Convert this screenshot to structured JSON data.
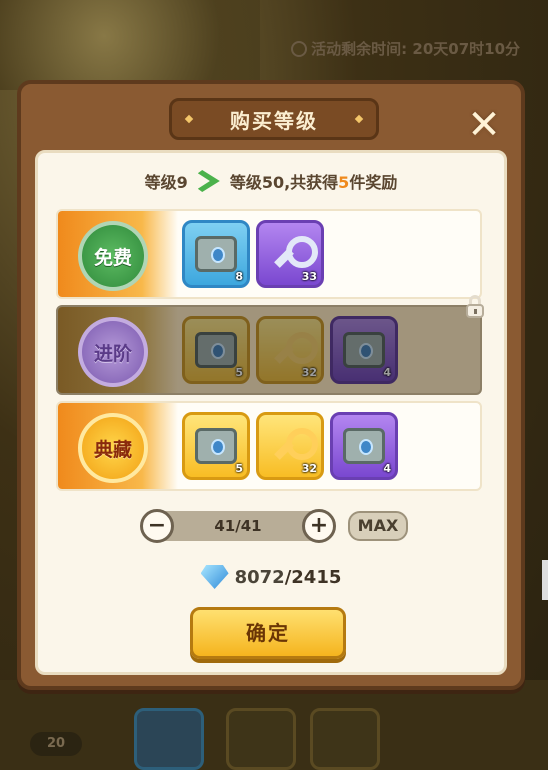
{
  "background": {
    "timer_text": "活动剩余时间: 20天07时10分",
    "chip_value": "20"
  },
  "dialog": {
    "title": "购买等级",
    "close_icon": "close-icon",
    "summary": {
      "from_level": "等级9",
      "to_level": "等级50,共获得",
      "reward_count": "5",
      "reward_suffix": "件奖励"
    },
    "tiers": [
      {
        "badge": "免费",
        "locked": false,
        "items": [
          {
            "icon": "chest-icon",
            "rarity": "blue",
            "qty": "8"
          },
          {
            "icon": "key-icon",
            "rarity": "purple",
            "qty": "33"
          }
        ]
      },
      {
        "badge": "进阶",
        "locked": true,
        "items": [
          {
            "icon": "chest-icon",
            "rarity": "gold",
            "qty": "5"
          },
          {
            "icon": "key-icon",
            "rarity": "gold",
            "qty": "32"
          },
          {
            "icon": "chest-icon",
            "rarity": "purple",
            "qty": "4"
          }
        ]
      },
      {
        "badge": "典藏",
        "locked": false,
        "items": [
          {
            "icon": "chest-icon",
            "rarity": "gold",
            "qty": "5"
          },
          {
            "icon": "key-icon",
            "rarity": "gold",
            "qty": "32"
          },
          {
            "icon": "chest-icon",
            "rarity": "purple",
            "qty": "4"
          }
        ]
      }
    ],
    "stepper": {
      "minus": "−",
      "plus": "+",
      "value": "41/41",
      "max_label": "MAX"
    },
    "cost": {
      "have": "8072",
      "separator": "/",
      "need": "2415"
    },
    "confirm_label": "确定"
  }
}
